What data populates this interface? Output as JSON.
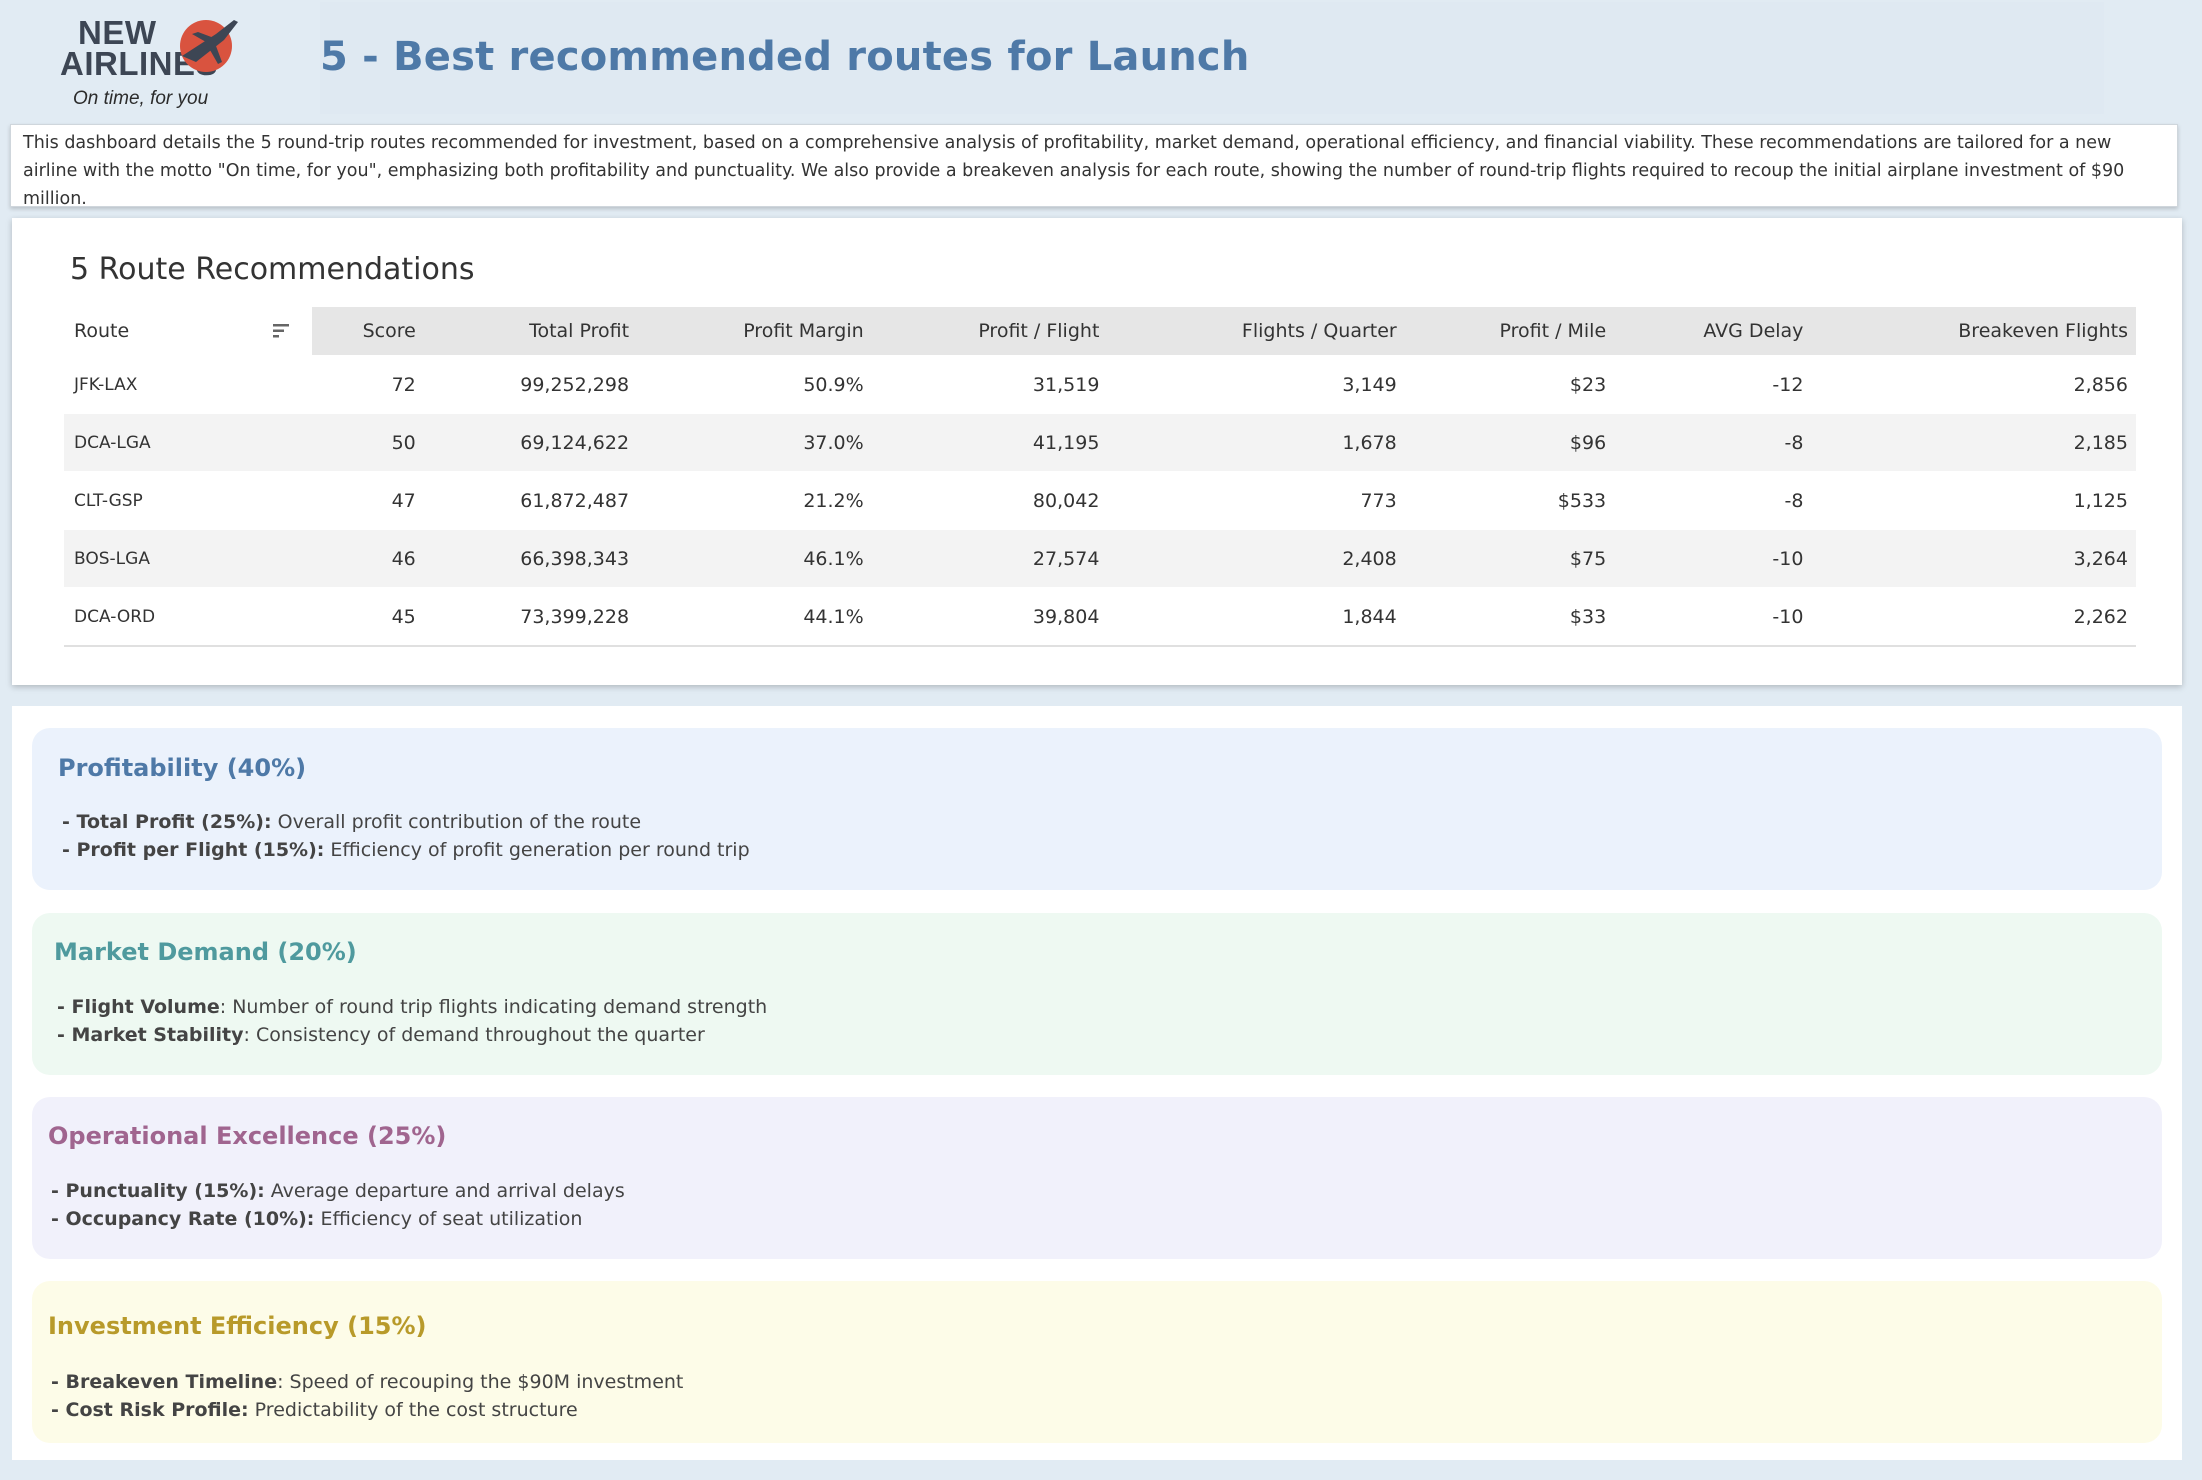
{
  "logo": {
    "line1": "NEW",
    "line2": "AIRLINES",
    "tagline": "On time, for you",
    "mark_icon": "plane-in-red-circle-icon",
    "mark_color": "#d9533f"
  },
  "header": {
    "title": "5 - Best recommended routes for Launch"
  },
  "intro": {
    "text": "This dashboard details the 5 round-trip routes recommended for investment, based on a comprehensive analysis of profitability, market demand, operational efficiency, and financial viability. These recommendations are tailored for a new airline with the motto \"On time, for you\", emphasizing both profitability and punctuality. We also provide a breakeven analysis for each route, showing the number of round-trip flights required to recoup the initial airplane investment of $90 million."
  },
  "table": {
    "title": "5 Route Recommendations",
    "sort_icon": "sort-descending-icon",
    "columns": [
      "Route",
      "Score",
      "Total Profit",
      "Profit Margin",
      "Profit / Flight",
      "Flights / Quarter",
      "Profit / Mile",
      "AVG Delay",
      "Breakeven Flights"
    ],
    "rows": [
      [
        "JFK-LAX",
        "72",
        "99,252,298",
        "50.9%",
        "31,519",
        "3,149",
        "$23",
        "-12",
        "2,856"
      ],
      [
        "DCA-LGA",
        "50",
        "69,124,622",
        "37.0%",
        "41,195",
        "1,678",
        "$96",
        "-8",
        "2,185"
      ],
      [
        "CLT-GSP",
        "47",
        "61,872,487",
        "21.2%",
        "80,042",
        "773",
        "$533",
        "-8",
        "1,125"
      ],
      [
        "BOS-LGA",
        "46",
        "66,398,343",
        "46.1%",
        "27,574",
        "2,408",
        "$75",
        "-10",
        "3,264"
      ],
      [
        "DCA-ORD",
        "45",
        "73,399,228",
        "44.1%",
        "39,804",
        "1,844",
        "$33",
        "-10",
        "2,262"
      ]
    ]
  },
  "criteria": {
    "profitability": {
      "title": "Profitability (40%)",
      "items": [
        {
          "term": "- Total Profit (25%):",
          "desc": " Overall profit contribution of the route"
        },
        {
          "term": "- Profit per Flight (15%):",
          "desc": " Efficiency of profit generation per round trip"
        }
      ]
    },
    "market_demand": {
      "title": "Market Demand (20%)",
      "items": [
        {
          "term": "- Flight Volume",
          "desc": ": Number of round trip flights indicating demand strength"
        },
        {
          "term": "- Market Stability",
          "desc": ": Consistency of demand throughout the quarter"
        }
      ]
    },
    "operational": {
      "title": "Operational Excellence (25%)",
      "items": [
        {
          "term": "- Punctuality (15%):",
          "desc": " Average departure and arrival delays"
        },
        {
          "term": "- Occupancy Rate (10%):",
          "desc": " Efficiency of seat utilization"
        }
      ]
    },
    "investment": {
      "title": "Investment Efficiency (15%)",
      "items": [
        {
          "term": "- Breakeven Timeline",
          "desc": ": Speed of recouping the $90M investment"
        },
        {
          "term": "- Cost Risk Profile:",
          "desc": " Predictability of the cost structure"
        }
      ]
    }
  }
}
